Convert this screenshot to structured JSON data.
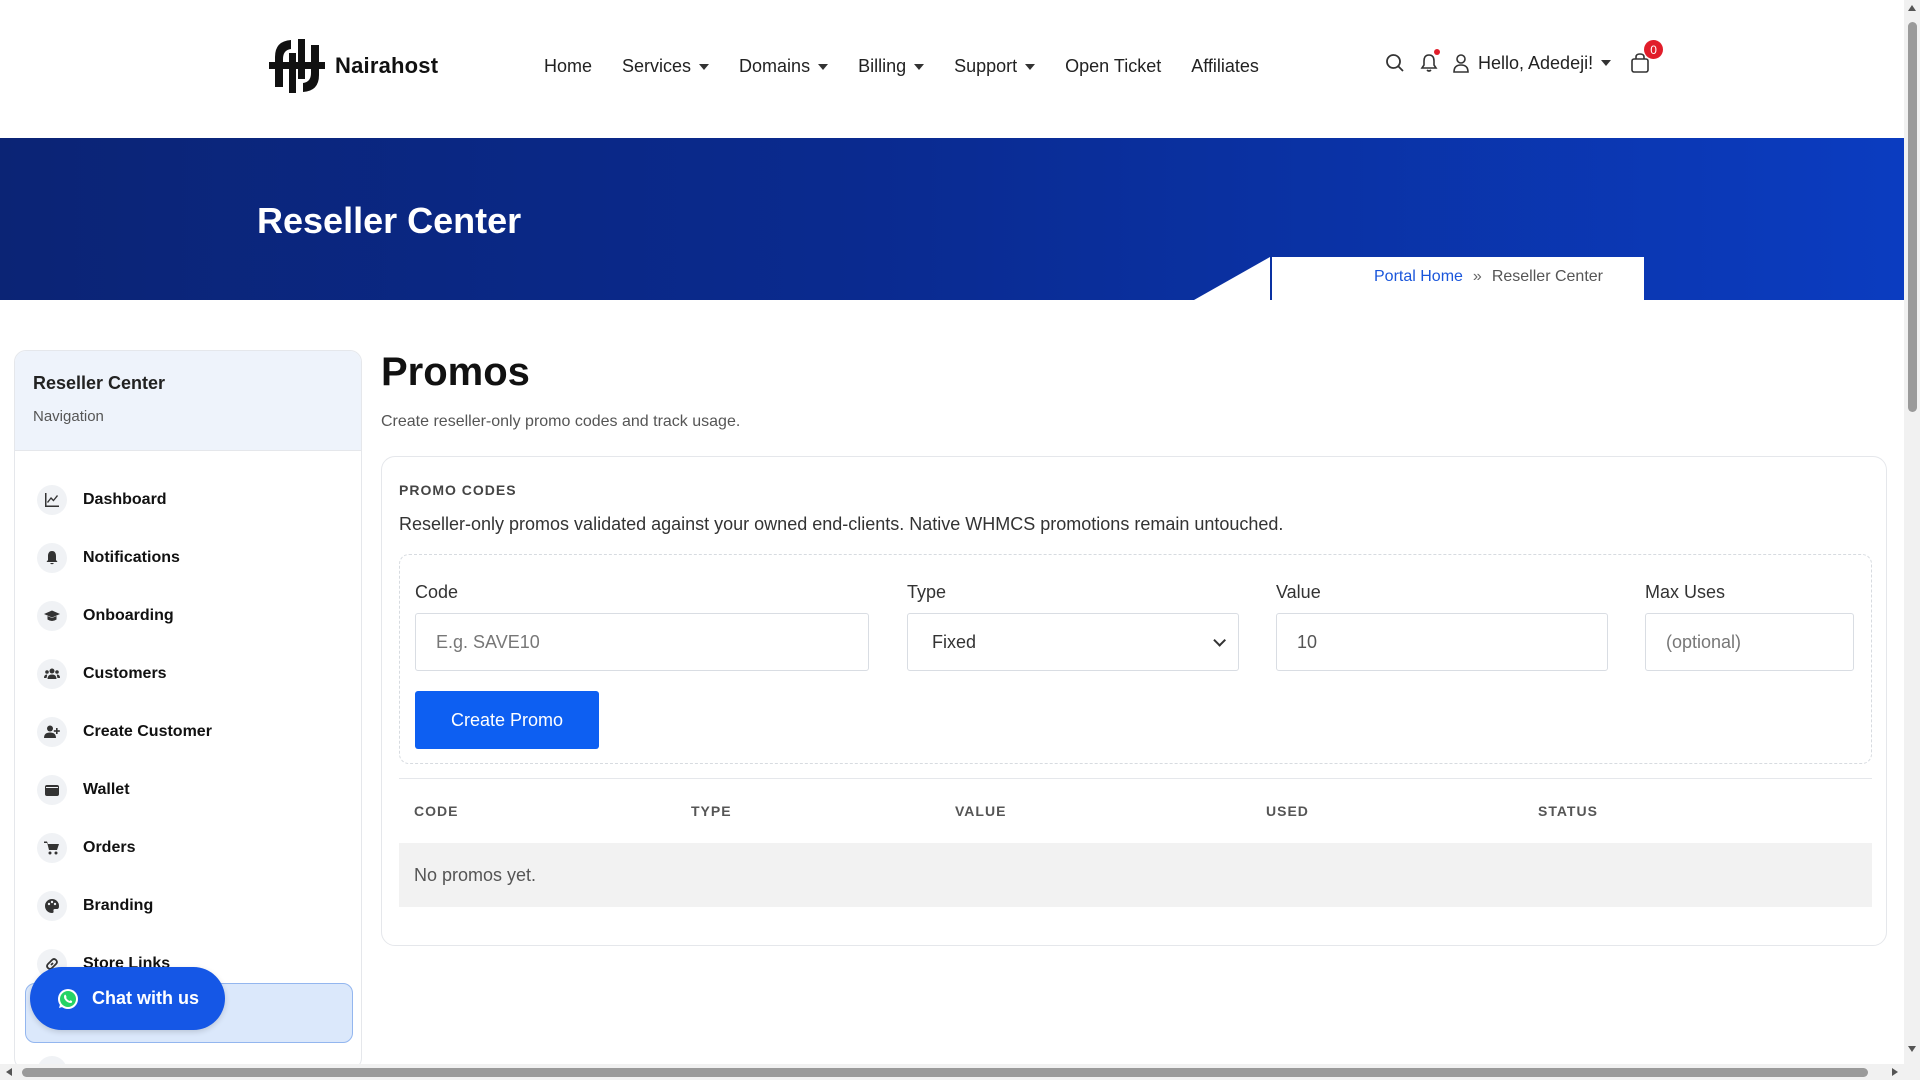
{
  "brand": {
    "name": "Nairahost"
  },
  "nav": {
    "items": [
      {
        "label": "Home",
        "dropdown": false
      },
      {
        "label": "Services",
        "dropdown": true
      },
      {
        "label": "Domains",
        "dropdown": true
      },
      {
        "label": "Billing",
        "dropdown": true
      },
      {
        "label": "Support",
        "dropdown": true
      },
      {
        "label": "Open Ticket",
        "dropdown": false
      },
      {
        "label": "Affiliates",
        "dropdown": false
      }
    ],
    "greeting": "Hello, Adedeji!",
    "cart_count": "0"
  },
  "banner": {
    "title": "Reseller Center",
    "breadcrumb": {
      "home": "Portal Home",
      "separator": "»",
      "current": "Reseller Center"
    }
  },
  "sidebar": {
    "title": "Reseller Center",
    "subtitle": "Navigation",
    "items": [
      {
        "label": "Dashboard",
        "icon": "chart-line-icon"
      },
      {
        "label": "Notifications",
        "icon": "bell-icon"
      },
      {
        "label": "Onboarding",
        "icon": "graduation-cap-icon"
      },
      {
        "label": "Customers",
        "icon": "users-icon"
      },
      {
        "label": "Create Customer",
        "icon": "user-plus-icon"
      },
      {
        "label": "Wallet",
        "icon": "wallet-icon"
      },
      {
        "label": "Orders",
        "icon": "cart-icon"
      },
      {
        "label": "Branding",
        "icon": "palette-icon"
      },
      {
        "label": "Store Links",
        "icon": "link-icon"
      }
    ]
  },
  "chat": {
    "label": "Chat with us"
  },
  "main": {
    "title": "Promos",
    "subtitle": "Create reseller-only promo codes and track usage.",
    "card": {
      "caption": "PROMO CODES",
      "description": "Reseller-only promos validated against your owned end-clients. Native WHMCS promotions remain untouched.",
      "form": {
        "code_label": "Code",
        "code_placeholder": "E.g. SAVE10",
        "type_label": "Type",
        "type_selected": "Fixed",
        "value_label": "Value",
        "value_value": "10",
        "max_uses_label": "Max Uses",
        "max_uses_placeholder": "(optional)",
        "submit_label": "Create Promo"
      },
      "table": {
        "columns": [
          "CODE",
          "TYPE",
          "VALUE",
          "USED",
          "STATUS"
        ],
        "empty_text": "No promos yet."
      }
    }
  },
  "colors": {
    "accent": "#0d5ff2",
    "banner_dark": "#0b2475",
    "badge": "#e11d2a"
  }
}
